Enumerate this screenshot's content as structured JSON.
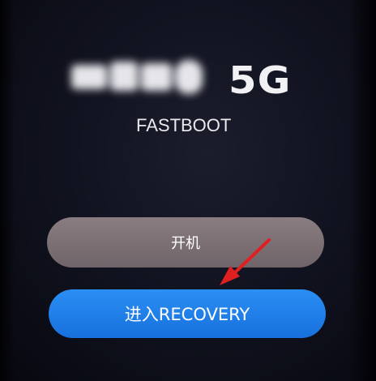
{
  "header": {
    "network_label": "5G",
    "mode_label": "FASTBOOT"
  },
  "buttons": {
    "power_on_label": "开机",
    "recovery_label": "进入RECOVERY"
  },
  "annotation": {
    "arrow_color": "#e02020"
  },
  "colors": {
    "background": "#111320",
    "power_on_button": "#7c7075",
    "recovery_button": "#1f80ea"
  }
}
